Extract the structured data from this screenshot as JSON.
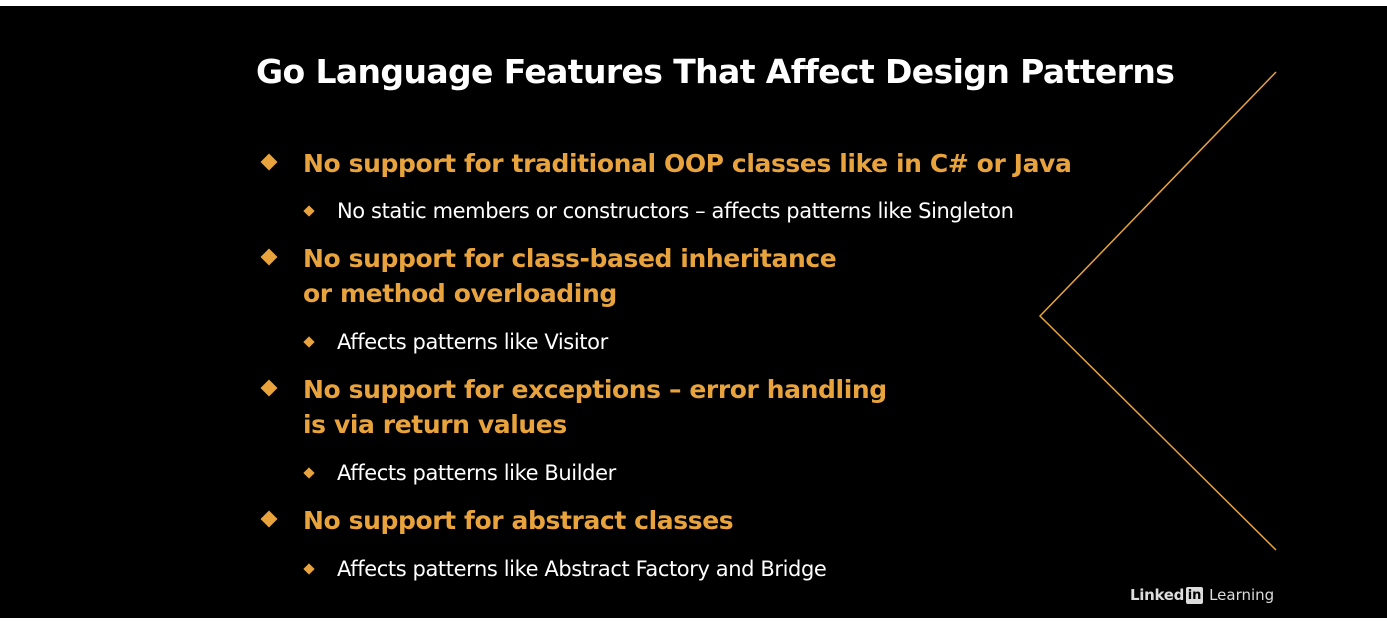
{
  "slide": {
    "title": "Go Language Features That Affect Design Patterns",
    "accent_color": "#E8A33D",
    "text_color": "#FFFFFF",
    "background_color": "#000000",
    "bullets": [
      {
        "lines": [
          "No support for traditional OOP classes like in C# or Java"
        ],
        "sub": "No static members or constructors – affects patterns like Singleton"
      },
      {
        "lines": [
          "No support for class-based inheritance",
          "or method overloading"
        ],
        "sub": "Affects patterns like Visitor"
      },
      {
        "lines": [
          "No support for exceptions – error handling",
          "is via return values"
        ],
        "sub": "Affects patterns like Builder"
      },
      {
        "lines": [
          "No support for abstract classes"
        ],
        "sub": "Affects patterns like Abstract Factory and Bridge"
      }
    ]
  },
  "logo": {
    "wordmark": "Linked",
    "badge": "in",
    "product": "Learning"
  }
}
